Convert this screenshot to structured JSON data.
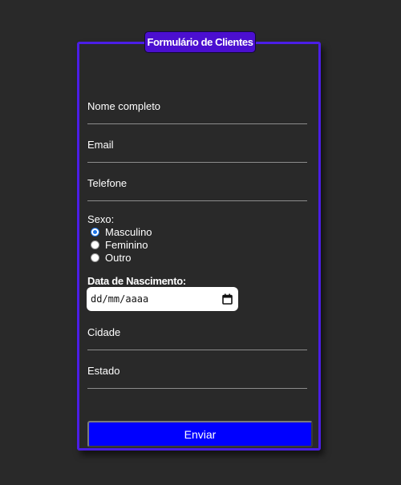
{
  "form": {
    "legend": "Formulário de Clientes",
    "fields": {
      "nome": "Nome completo",
      "email": "Email",
      "telefone": "Telefone",
      "cidade": "Cidade",
      "estado": "Estado"
    },
    "sexo": {
      "label": "Sexo:",
      "options": [
        "Masculino",
        "Feminino",
        "Outro"
      ],
      "selected": "Masculino"
    },
    "nascimento": {
      "label": "Data de Nascimento:",
      "placeholder": "dd/mm/aaaa",
      "icon": "calendar-icon"
    },
    "submit_label": "Enviar"
  },
  "colors": {
    "background": "#292929",
    "border": "#4b1ee6",
    "legend": "#4b0fd0",
    "button": "#0000ff",
    "radio_checked": "#1a73e8"
  }
}
